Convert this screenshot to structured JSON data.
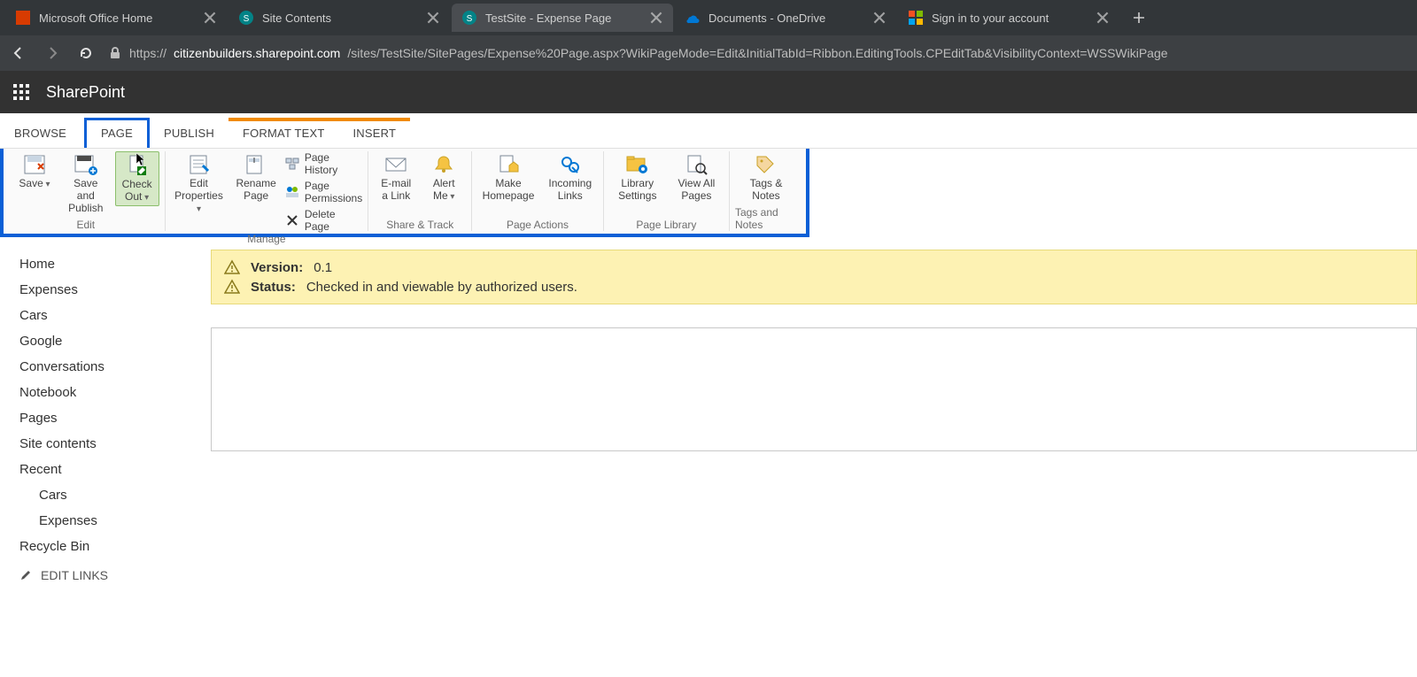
{
  "browser": {
    "tabs": [
      {
        "title": "Microsoft Office Home",
        "favicon": "office"
      },
      {
        "title": "Site Contents",
        "favicon": "sp"
      },
      {
        "title": "TestSite - Expense Page",
        "favicon": "sp",
        "active": true
      },
      {
        "title": "Documents - OneDrive",
        "favicon": "onedrive"
      },
      {
        "title": "Sign in to your account",
        "favicon": "ms"
      }
    ],
    "url_prefix": "https://",
    "url_host": "citizenbuilders.sharepoint.com",
    "url_path": "/sites/TestSite/SitePages/Expense%20Page.aspx?WikiPageMode=Edit&InitialTabId=Ribbon.EditingTools.CPEditTab&VisibilityContext=WSSWikiPage"
  },
  "sp_header": {
    "title": "SharePoint"
  },
  "ribbon_tabs": {
    "browse": "BROWSE",
    "page": "PAGE",
    "publish": "PUBLISH",
    "format_text": "FORMAT TEXT",
    "insert": "INSERT"
  },
  "ribbon": {
    "edit": {
      "save": "Save",
      "save_publish": "Save and Publish",
      "check_out": "Check Out",
      "group_label": "Edit"
    },
    "manage": {
      "edit_properties": "Edit Properties",
      "rename_page": "Rename Page",
      "page_history": "Page History",
      "page_permissions": "Page Permissions",
      "delete_page": "Delete Page",
      "group_label": "Manage"
    },
    "share_track": {
      "email": "E-mail a Link",
      "alert": "Alert Me",
      "group_label": "Share & Track"
    },
    "page_actions": {
      "make_homepage": "Make Homepage",
      "incoming_links": "Incoming Links",
      "group_label": "Page Actions"
    },
    "page_library": {
      "library_settings": "Library Settings",
      "view_all": "View All Pages",
      "group_label": "Page Library"
    },
    "tags_notes": {
      "tags_notes": "Tags & Notes",
      "group_label": "Tags and Notes"
    }
  },
  "quicklaunch": {
    "items": [
      "Home",
      "Expenses",
      "Cars",
      "Google",
      "Conversations",
      "Notebook",
      "Pages",
      "Site contents",
      "Recent"
    ],
    "recent": [
      "Cars",
      "Expenses"
    ],
    "recycle": "Recycle Bin",
    "edit_links": "EDIT LINKS"
  },
  "status": {
    "version_label": "Version:",
    "version_value": "0.1",
    "status_label": "Status:",
    "status_value": "Checked in and viewable by authorized users."
  }
}
